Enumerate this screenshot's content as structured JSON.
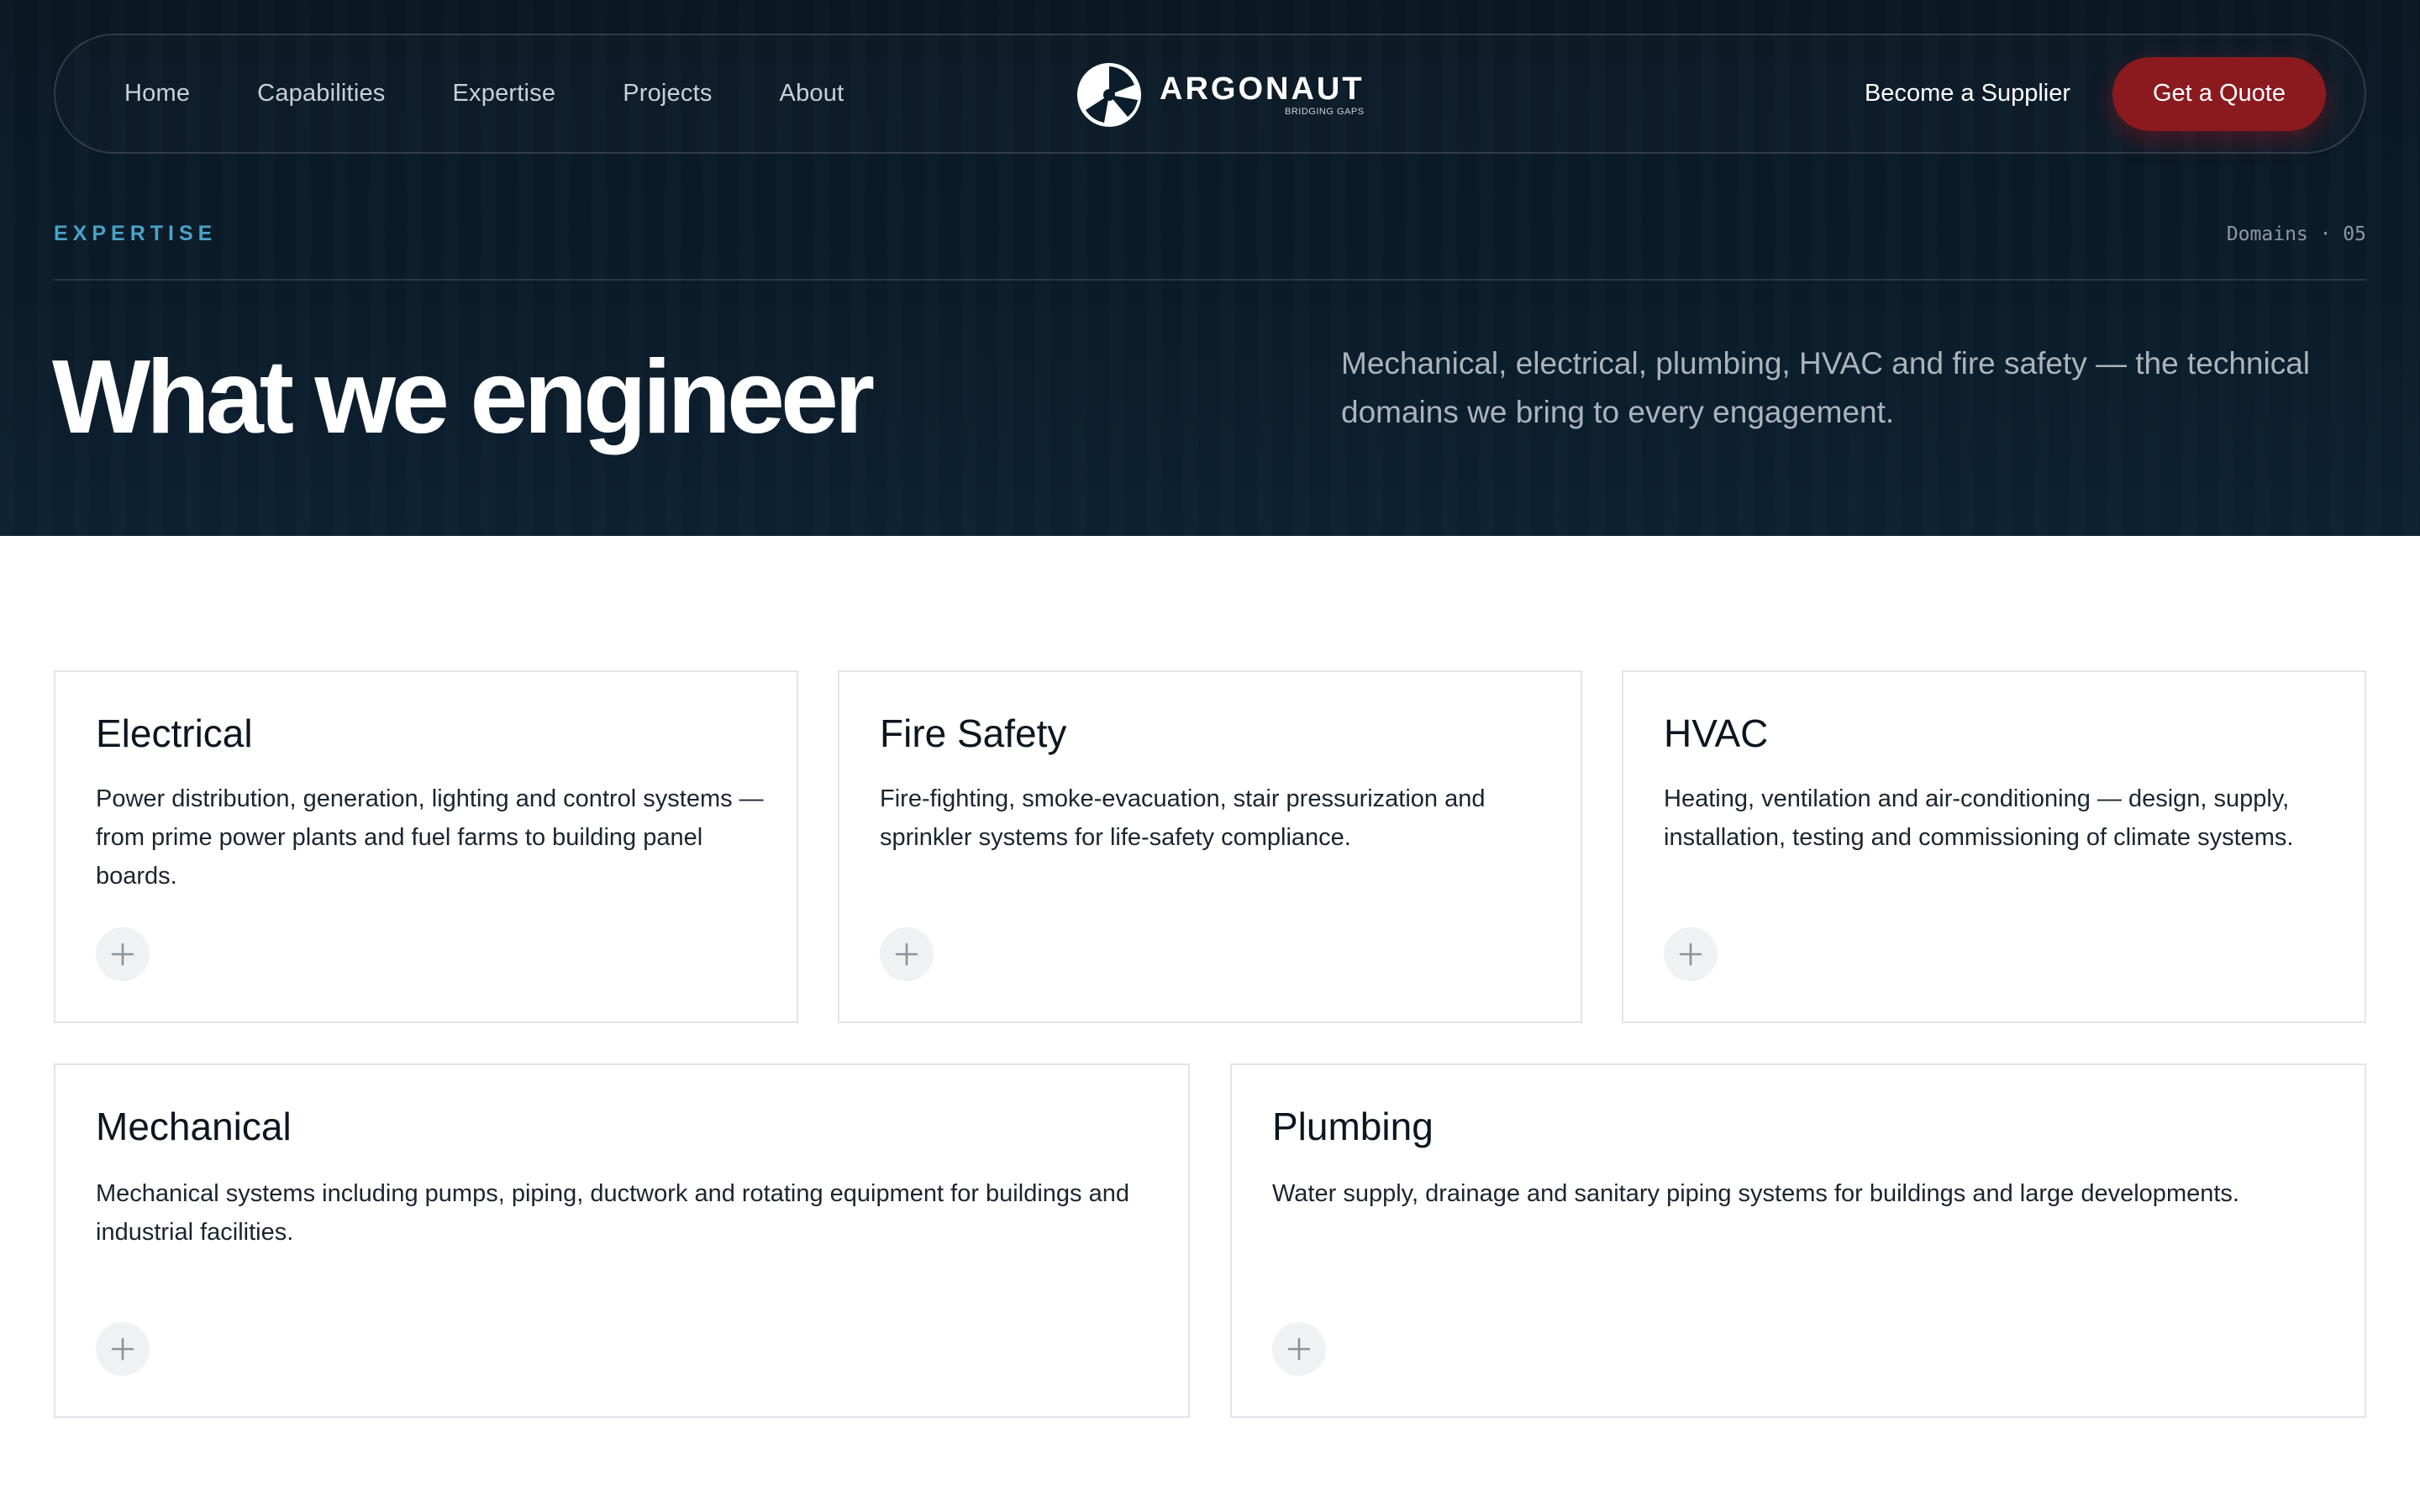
{
  "nav": {
    "links": [
      "Home",
      "Capabilities",
      "Expertise",
      "Projects",
      "About"
    ],
    "logo_word": "ARGONAUT",
    "logo_tagline": "BRIDGING GAPS",
    "supplier_label": "Become a Supplier",
    "quote_label": "Get a Quote"
  },
  "hero": {
    "eyebrow": "EXPERTISE",
    "domains_label": "Domains · 05",
    "headline": "What we engineer",
    "intro": "Mechanical, electrical, plumbing, HVAC and fire safety — the technical domains we bring to every engagement."
  },
  "cards": [
    {
      "title": "Electrical",
      "text": "Power distribution, generation, lighting and control systems — from prime power plants and fuel farms to building panel boards."
    },
    {
      "title": "Fire Safety",
      "text": "Fire-fighting, smoke-evacuation, stair pressurization and sprinkler systems for life-safety compliance."
    },
    {
      "title": "HVAC",
      "text": "Heating, ventilation and air-conditioning — design, supply, installation, testing and commissioning of climate systems."
    },
    {
      "title": "Mechanical",
      "text": "Mechanical systems including pumps, piping, ductwork and rotating equipment for buildings and industrial facilities."
    },
    {
      "title": "Plumbing",
      "text": "Water supply, drainage and sanitary piping systems for buildings and large developments."
    }
  ],
  "colors": {
    "hero_bg": "#0b1c2a",
    "accent_red": "#8b1a1f",
    "eyebrow_blue": "#4aa3c7",
    "card_border": "#e2e5e8"
  },
  "icons": {
    "card_expand": "plus-icon",
    "logo": "argonaut-logo-icon"
  }
}
